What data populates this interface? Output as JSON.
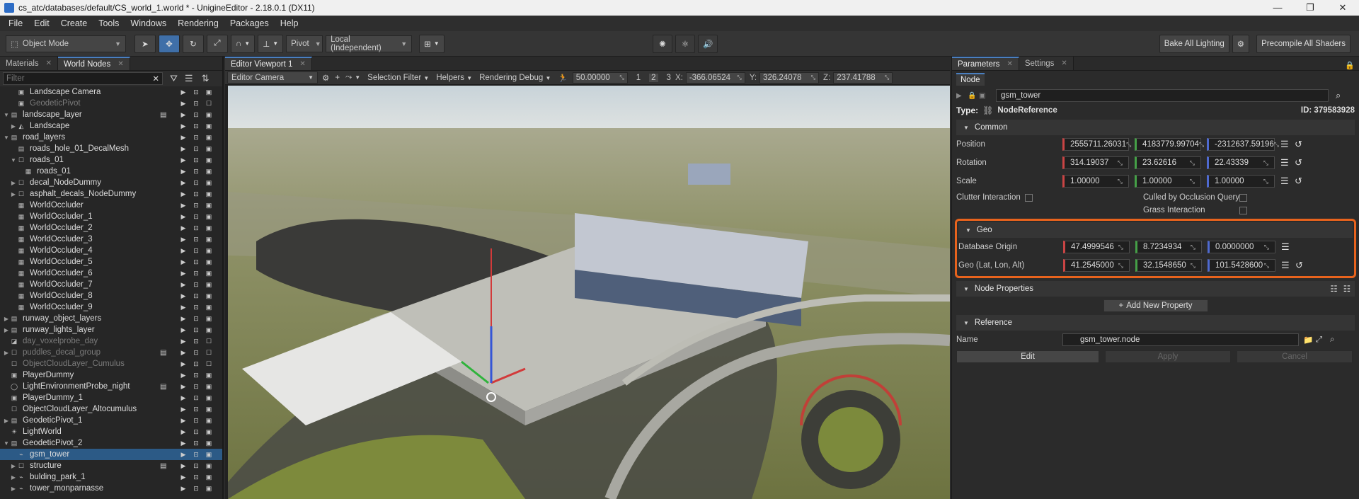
{
  "window": {
    "title": "cs_atc/databases/default/CS_world_1.world * - UnigineEditor - 2.18.0.1 (DX11)",
    "minimize": "—",
    "maximize": "❐",
    "close": "✕"
  },
  "menu": [
    "File",
    "Edit",
    "Create",
    "Tools",
    "Windows",
    "Rendering",
    "Packages",
    "Help"
  ],
  "toolbar": {
    "mode": "Object Mode",
    "pivot": "Pivot",
    "space": "Local (Independent)",
    "bake_lighting": "Bake All Lighting",
    "precompile": "Precompile All Shaders"
  },
  "left_panel": {
    "tabs": [
      "Materials",
      "World Nodes"
    ],
    "active_tab": "World Nodes",
    "filter_placeholder": "Filter",
    "nodes": [
      {
        "label": "Landscape Camera",
        "depth": 1,
        "exp": "",
        "icon": "▣",
        "dim": false,
        "sel": false,
        "doc": false
      },
      {
        "label": "GeodeticPivot",
        "depth": 1,
        "exp": "",
        "icon": "▣",
        "dim": true,
        "sel": false,
        "doc": false
      },
      {
        "label": "landscape_layer",
        "depth": 0,
        "exp": "▼",
        "icon": "▤",
        "dim": false,
        "sel": false,
        "doc": true
      },
      {
        "label": "Landscape",
        "depth": 1,
        "exp": "▶",
        "icon": "◭",
        "dim": false,
        "sel": false,
        "doc": false
      },
      {
        "label": "road_layers",
        "depth": 0,
        "exp": "▼",
        "icon": "▤",
        "dim": false,
        "sel": false,
        "doc": false
      },
      {
        "label": "roads_hole_01_DecalMesh",
        "depth": 1,
        "exp": "",
        "icon": "▤",
        "dim": false,
        "sel": false,
        "doc": false
      },
      {
        "label": "roads_01",
        "depth": 1,
        "exp": "▼",
        "icon": "☐",
        "dim": false,
        "sel": false,
        "doc": false
      },
      {
        "label": "roads_01",
        "depth": 2,
        "exp": "",
        "icon": "▦",
        "dim": false,
        "sel": false,
        "doc": false
      },
      {
        "label": "decal_NodeDummy",
        "depth": 1,
        "exp": "▶",
        "icon": "☐",
        "dim": false,
        "sel": false,
        "doc": false
      },
      {
        "label": "asphalt_decals_NodeDummy",
        "depth": 1,
        "exp": "▶",
        "icon": "☐",
        "dim": false,
        "sel": false,
        "doc": false
      },
      {
        "label": "WorldOccluder",
        "depth": 1,
        "exp": "",
        "icon": "▦",
        "dim": false,
        "sel": false,
        "doc": false
      },
      {
        "label": "WorldOccluder_1",
        "depth": 1,
        "exp": "",
        "icon": "▦",
        "dim": false,
        "sel": false,
        "doc": false
      },
      {
        "label": "WorldOccluder_2",
        "depth": 1,
        "exp": "",
        "icon": "▦",
        "dim": false,
        "sel": false,
        "doc": false
      },
      {
        "label": "WorldOccluder_3",
        "depth": 1,
        "exp": "",
        "icon": "▦",
        "dim": false,
        "sel": false,
        "doc": false
      },
      {
        "label": "WorldOccluder_4",
        "depth": 1,
        "exp": "",
        "icon": "▦",
        "dim": false,
        "sel": false,
        "doc": false
      },
      {
        "label": "WorldOccluder_5",
        "depth": 1,
        "exp": "",
        "icon": "▦",
        "dim": false,
        "sel": false,
        "doc": false
      },
      {
        "label": "WorldOccluder_6",
        "depth": 1,
        "exp": "",
        "icon": "▦",
        "dim": false,
        "sel": false,
        "doc": false
      },
      {
        "label": "WorldOccluder_7",
        "depth": 1,
        "exp": "",
        "icon": "▦",
        "dim": false,
        "sel": false,
        "doc": false
      },
      {
        "label": "WorldOccluder_8",
        "depth": 1,
        "exp": "",
        "icon": "▦",
        "dim": false,
        "sel": false,
        "doc": false
      },
      {
        "label": "WorldOccluder_9",
        "depth": 1,
        "exp": "",
        "icon": "▦",
        "dim": false,
        "sel": false,
        "doc": false
      },
      {
        "label": "runway_object_layers",
        "depth": 0,
        "exp": "▶",
        "icon": "▤",
        "dim": false,
        "sel": false,
        "doc": false
      },
      {
        "label": "runway_lights_layer",
        "depth": 0,
        "exp": "▶",
        "icon": "▤",
        "dim": false,
        "sel": false,
        "doc": false
      },
      {
        "label": "day_voxelprobe_day",
        "depth": 0,
        "exp": "",
        "icon": "◪",
        "dim": true,
        "sel": false,
        "doc": false
      },
      {
        "label": "puddles_decal_group",
        "depth": 0,
        "exp": "▶",
        "icon": "☐",
        "dim": true,
        "sel": false,
        "doc": true
      },
      {
        "label": "ObjectCloudLayer_Cumulus",
        "depth": 0,
        "exp": "",
        "icon": "☐",
        "dim": true,
        "sel": false,
        "doc": false
      },
      {
        "label": "PlayerDummy",
        "depth": 0,
        "exp": "",
        "icon": "▣",
        "dim": false,
        "sel": false,
        "doc": false
      },
      {
        "label": "LightEnvironmentProbe_night",
        "depth": 0,
        "exp": "",
        "icon": "◯",
        "dim": false,
        "sel": false,
        "doc": true
      },
      {
        "label": "PlayerDummy_1",
        "depth": 0,
        "exp": "",
        "icon": "▣",
        "dim": false,
        "sel": false,
        "doc": false
      },
      {
        "label": "ObjectCloudLayer_Altocumulus",
        "depth": 0,
        "exp": "",
        "icon": "☐",
        "dim": false,
        "sel": false,
        "doc": false
      },
      {
        "label": "GeodeticPivot_1",
        "depth": 0,
        "exp": "▶",
        "icon": "▤",
        "dim": false,
        "sel": false,
        "doc": false
      },
      {
        "label": "LightWorld",
        "depth": 0,
        "exp": "",
        "icon": "☀",
        "dim": false,
        "sel": false,
        "doc": false
      },
      {
        "label": "GeodeticPivot_2",
        "depth": 0,
        "exp": "▼",
        "icon": "▤",
        "dim": false,
        "sel": false,
        "doc": false
      },
      {
        "label": "gsm_tower",
        "depth": 1,
        "exp": "",
        "icon": "⌁",
        "dim": false,
        "sel": true,
        "doc": false
      },
      {
        "label": "structure",
        "depth": 1,
        "exp": "▶",
        "icon": "☐",
        "dim": false,
        "sel": false,
        "doc": true
      },
      {
        "label": "bulding_park_1",
        "depth": 1,
        "exp": "▶",
        "icon": "⌁",
        "dim": false,
        "sel": false,
        "doc": false
      },
      {
        "label": "tower_monparnasse",
        "depth": 1,
        "exp": "▶",
        "icon": "⌁",
        "dim": false,
        "sel": false,
        "doc": false
      }
    ]
  },
  "viewport": {
    "tab": "Editor Viewport 1",
    "camera": "Editor Camera",
    "selection_filter": "Selection Filter",
    "helpers": "Helpers",
    "rendering_debug": "Rendering Debug",
    "speed": "50.00000",
    "pages": [
      "1",
      "2",
      "3"
    ],
    "x_label": "X:",
    "x": "-366.06524",
    "y_label": "Y:",
    "y": "326.24078",
    "z_label": "Z:",
    "z": "237.41788"
  },
  "parameters": {
    "tabs": [
      "Parameters",
      "Settings"
    ],
    "subtab": "Node",
    "node_name": "gsm_tower",
    "type_label": "Type:",
    "type_value": "NodeReference",
    "id": "ID: 379583928",
    "common": {
      "title": "Common",
      "position_label": "Position",
      "position": [
        "2555711.26031",
        "4183779.99704",
        "-2312637.59196"
      ],
      "rotation_label": "Rotation",
      "rotation": [
        "314.19037",
        "23.62616",
        "22.43339"
      ],
      "scale_label": "Scale",
      "scale": [
        "1.00000",
        "1.00000",
        "1.00000"
      ],
      "clutter": "Clutter Interaction",
      "culled": "Culled by Occlusion Query",
      "grass": "Grass Interaction"
    },
    "geo": {
      "title": "Geo",
      "db_origin_label": "Database Origin",
      "db_origin": [
        "47.4999546",
        "8.7234934",
        "0.0000000"
      ],
      "geo_label": "Geo (Lat, Lon, Alt)",
      "geo": [
        "41.2545000",
        "32.1548650",
        "101.5428600"
      ]
    },
    "node_properties": {
      "title": "Node Properties",
      "add": "Add New Property"
    },
    "reference": {
      "title": "Reference",
      "name_label": "Name",
      "name": "gsm_tower.node",
      "edit": "Edit",
      "apply": "Apply",
      "cancel": "Cancel"
    }
  },
  "colors": {
    "accent": "#4a7fc0",
    "highlight_box": "#e8631d",
    "x_axis": "#c94444",
    "y_axis": "#45a047",
    "z_axis": "#4f6ad0",
    "selection": "#2c5a86"
  }
}
